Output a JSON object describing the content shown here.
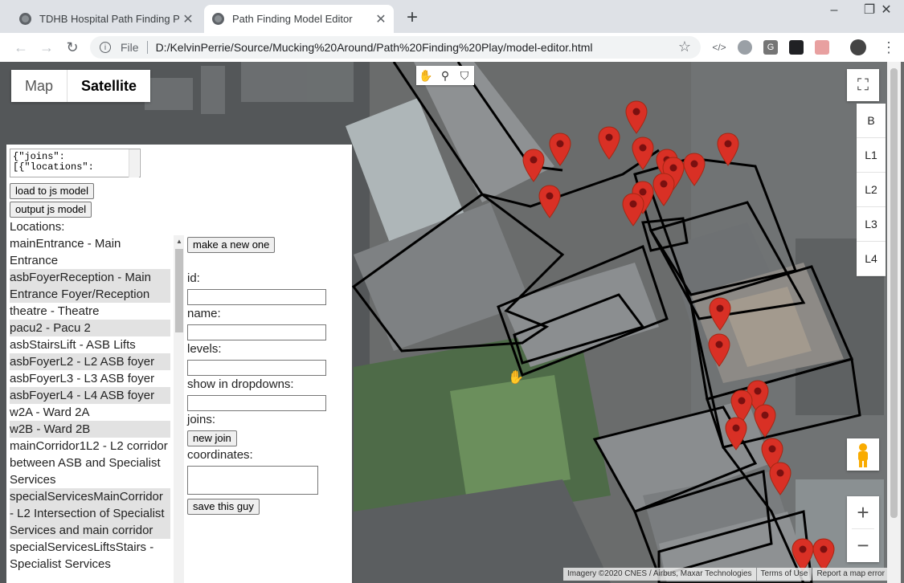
{
  "browser": {
    "tabs": [
      {
        "title": "TDHB Hospital Path Finding PoC",
        "active": false
      },
      {
        "title": "Path Finding Model Editor",
        "active": true
      }
    ],
    "url_prefix": "File",
    "url": "D:/KelvinPerrie/Source/Mucking%20Around/Path%20Finding%20Play/model-editor.html"
  },
  "map": {
    "type_buttons": [
      "Map",
      "Satellite"
    ],
    "selected_type": "Satellite",
    "levels": [
      "B",
      "L1",
      "L2",
      "L3",
      "L4"
    ],
    "zoom_in": "+",
    "zoom_out": "−",
    "attribution": [
      "Imagery ©2020 CNES / Airbus, Maxar Technologies",
      "Terms of Use",
      "Report a map error"
    ],
    "marker_color": "#d93025"
  },
  "editor": {
    "json_text": "{\"joins\":\n[{\"locations\":",
    "load_button": "load to js model",
    "output_button": "output js model",
    "locations_label": "Locations:",
    "locations": [
      "mainEntrance - Main Entrance",
      "asbFoyerReception - Main Entrance Foyer/Reception",
      "theatre - Theatre",
      "pacu2 - Pacu 2",
      "asbStairsLift - ASB Lifts",
      "asbFoyerL2 - L2 ASB foyer",
      "asbFoyerL3 - L3 ASB foyer",
      "asbFoyerL4 - L4 ASB foyer",
      "w2A - Ward 2A",
      "w2B - Ward 2B",
      "mainCorridor1L2 - L2 corridor between ASB and Specialist Services",
      "specialServicesMainCorridor - L2 Intersection of Specialist Services and main corridor",
      "specialServicesLiftsStairs - Specialist Services"
    ],
    "make_new_button": "make a new one",
    "fields": {
      "id": "id:",
      "name": "name:",
      "levels": "levels:",
      "show": "show in dropdowns:",
      "joins": "joins:",
      "coordinates": "coordinates:"
    },
    "new_join_button": "new join",
    "save_button": "save this guy"
  }
}
